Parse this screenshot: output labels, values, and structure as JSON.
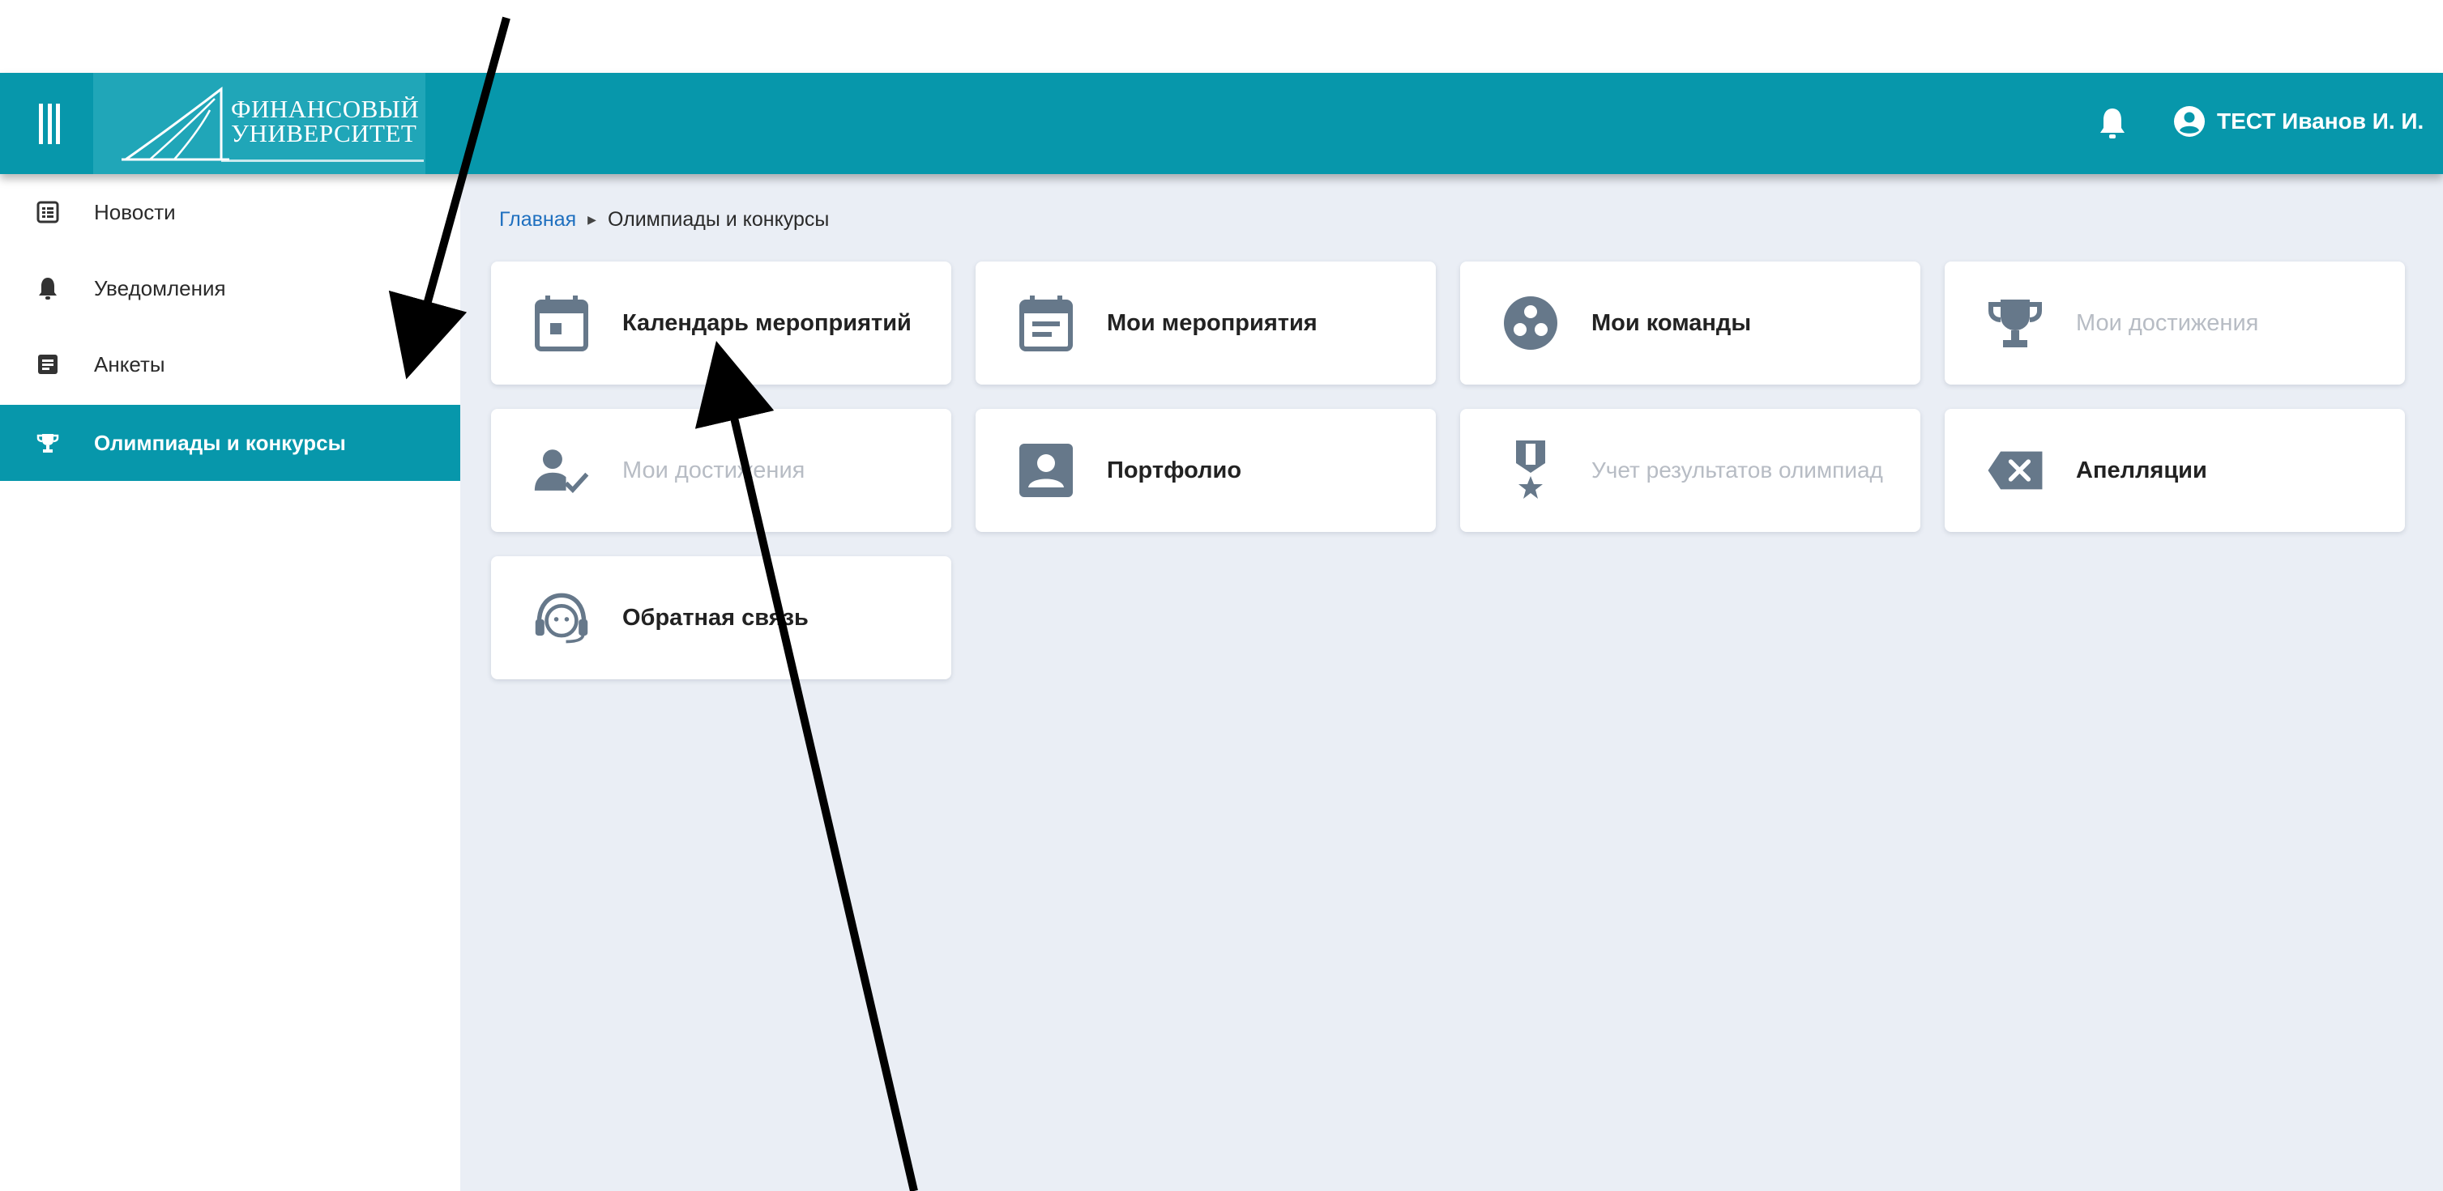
{
  "header": {
    "logo_line1": "ФИНАНСОВЫЙ",
    "logo_line2": "УНИВЕРСИТЕТ",
    "user_name": "ТЕСТ Иванов И. И.",
    "bell_icon": "bell-icon",
    "user_icon": "user-circle-icon",
    "menu_icon": "hamburger-icon",
    "color": "#0797ab"
  },
  "sidebar": {
    "items": [
      {
        "label": "Новости",
        "icon": "news-list-icon",
        "active": false
      },
      {
        "label": "Уведомления",
        "icon": "bell-icon",
        "active": false
      },
      {
        "label": "Анкеты",
        "icon": "form-icon",
        "active": false
      },
      {
        "label": "Олимпиады и конкурсы",
        "icon": "trophy-icon",
        "active": true
      }
    ]
  },
  "breadcrumb": {
    "home": "Главная",
    "current": "Олимпиады и конкурсы"
  },
  "cards": [
    {
      "label": "Календарь мероприятий",
      "icon": "calendar-icon",
      "disabled": false
    },
    {
      "label": "Мои мероприятия",
      "icon": "calendar-list-icon",
      "disabled": false
    },
    {
      "label": "Мои команды",
      "icon": "team-icon",
      "disabled": false
    },
    {
      "label": "Мои достижения",
      "icon": "trophy-icon",
      "disabled": true
    },
    {
      "label": "Мои достижения",
      "icon": "user-check-icon",
      "disabled": true
    },
    {
      "label": "Портфолио",
      "icon": "portfolio-icon",
      "disabled": false
    },
    {
      "label": "Учет результатов олимпиад",
      "icon": "medal-icon",
      "disabled": true
    },
    {
      "label": "Апелляции",
      "icon": "backspace-x-icon",
      "disabled": false
    },
    {
      "label": "Обратная связь",
      "icon": "headset-icon",
      "disabled": false
    }
  ],
  "colors": {
    "accent": "#0797ab",
    "link": "#1e6fbf",
    "icon_gray": "#66788a",
    "disabled_text": "#b7bcc4",
    "main_bg": "#eaeef5"
  }
}
